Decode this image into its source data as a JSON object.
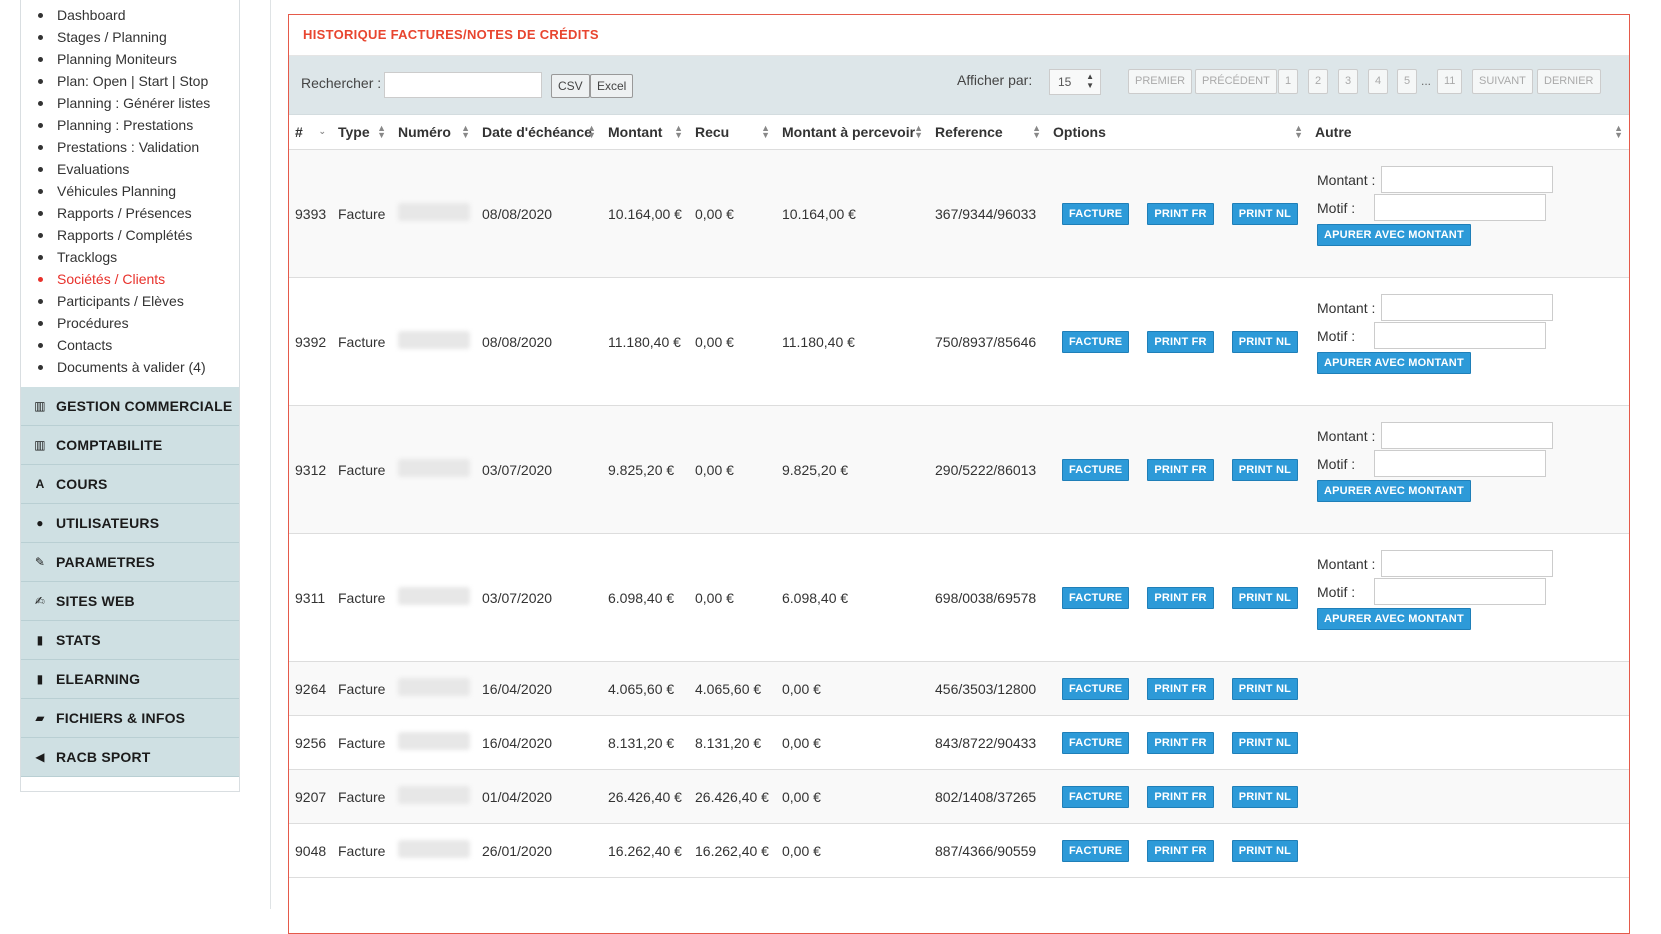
{
  "sidebar": {
    "links": [
      {
        "label": "Dashboard"
      },
      {
        "label": "Stages / Planning"
      },
      {
        "label": "Planning Moniteurs"
      },
      {
        "label": "Plan: Open | Start | Stop"
      },
      {
        "label": "Planning : Générer listes"
      },
      {
        "label": "Planning : Prestations"
      },
      {
        "label": "Prestations : Validation"
      },
      {
        "label": "Evaluations"
      },
      {
        "label": "Véhicules Planning"
      },
      {
        "label": "Rapports / Présences"
      },
      {
        "label": "Rapports / Complétés"
      },
      {
        "label": "Tracklogs"
      },
      {
        "label": "Sociétés / Clients",
        "active": true
      },
      {
        "label": "Participants / Elèves"
      },
      {
        "label": "Procédures"
      },
      {
        "label": "Contacts"
      },
      {
        "label": "Documents à valider (4)"
      }
    ],
    "sections": [
      {
        "label": "GESTION COMMERCIALE",
        "icon": "barcode-icon",
        "glyph": "▥"
      },
      {
        "label": "COMPTABILITE",
        "icon": "barcode-icon",
        "glyph": "▥"
      },
      {
        "label": "COURS",
        "icon": "font-icon",
        "glyph": "A"
      },
      {
        "label": "UTILISATEURS",
        "icon": "user-icon",
        "glyph": "●"
      },
      {
        "label": "PARAMETRES",
        "icon": "wrench-icon",
        "glyph": "✎"
      },
      {
        "label": "SITES WEB",
        "icon": "edit-icon",
        "glyph": "✍"
      },
      {
        "label": "STATS",
        "icon": "signal-icon",
        "glyph": "▮"
      },
      {
        "label": "ELEARNING",
        "icon": "signal-icon",
        "glyph": "▮"
      },
      {
        "label": "FICHIERS & INFOS",
        "icon": "folder-open-icon",
        "glyph": "▰"
      },
      {
        "label": "RACB SPORT",
        "icon": "bullhorn-icon",
        "glyph": "◀"
      }
    ]
  },
  "panel": {
    "title": "HISTORIQUE FACTURES/NOTES DE CRÉDITS",
    "search_label": "Rechercher :",
    "search_value": "",
    "csv_label": "CSV",
    "excel_label": "Excel",
    "show_label": "Afficher par:",
    "per_page": "15",
    "pagination": {
      "first": "PREMIER",
      "prev": "PRÉCÉDENT",
      "pages": [
        "1",
        "2",
        "3",
        "4",
        "5"
      ],
      "ellipsis": "...",
      "last_page": "11",
      "next": "SUIVANT",
      "last": "DERNIER"
    }
  },
  "table": {
    "headers": [
      "#",
      "Type",
      "Numéro",
      "Date d'échéance",
      "Montant",
      "Recu",
      "Montant à percevoir",
      "Reference",
      "Options",
      "Autre"
    ],
    "buttons": {
      "facture": "FACTURE",
      "print_fr": "PRINT FR",
      "print_nl": "PRINT NL"
    },
    "autre": {
      "montant_label": "Montant :",
      "motif_label": "Motif :",
      "apurer_label": "APURER AVEC MONTANT"
    },
    "rows": [
      {
        "id": "9393",
        "type": "Facture",
        "date": "08/08/2020",
        "montant": "10.164,00 €",
        "recu": "0,00 €",
        "percevoir": "10.164,00 €",
        "reference": "367/9344/96033",
        "autre": true
      },
      {
        "id": "9392",
        "type": "Facture",
        "date": "08/08/2020",
        "montant": "11.180,40 €",
        "recu": "0,00 €",
        "percevoir": "11.180,40 €",
        "reference": "750/8937/85646",
        "autre": true
      },
      {
        "id": "9312",
        "type": "Facture",
        "date": "03/07/2020",
        "montant": "9.825,20 €",
        "recu": "0,00 €",
        "percevoir": "9.825,20 €",
        "reference": "290/5222/86013",
        "autre": true
      },
      {
        "id": "9311",
        "type": "Facture",
        "date": "03/07/2020",
        "montant": "6.098,40 €",
        "recu": "0,00 €",
        "percevoir": "6.098,40 €",
        "reference": "698/0038/69578",
        "autre": true
      },
      {
        "id": "9264",
        "type": "Facture",
        "date": "16/04/2020",
        "montant": "4.065,60 €",
        "recu": "4.065,60 €",
        "percevoir": "0,00 €",
        "reference": "456/3503/12800",
        "autre": false
      },
      {
        "id": "9256",
        "type": "Facture",
        "date": "16/04/2020",
        "montant": "8.131,20 €",
        "recu": "8.131,20 €",
        "percevoir": "0,00 €",
        "reference": "843/8722/90433",
        "autre": false
      },
      {
        "id": "9207",
        "type": "Facture",
        "date": "01/04/2020",
        "montant": "26.426,40 €",
        "recu": "26.426,40 €",
        "percevoir": "0,00 €",
        "reference": "802/1408/37265",
        "autre": false
      },
      {
        "id": "9048",
        "type": "Facture",
        "date": "26/01/2020",
        "montant": "16.262,40 €",
        "recu": "16.262,40 €",
        "percevoir": "0,00 €",
        "reference": "887/4366/90559",
        "autre": false
      }
    ]
  }
}
